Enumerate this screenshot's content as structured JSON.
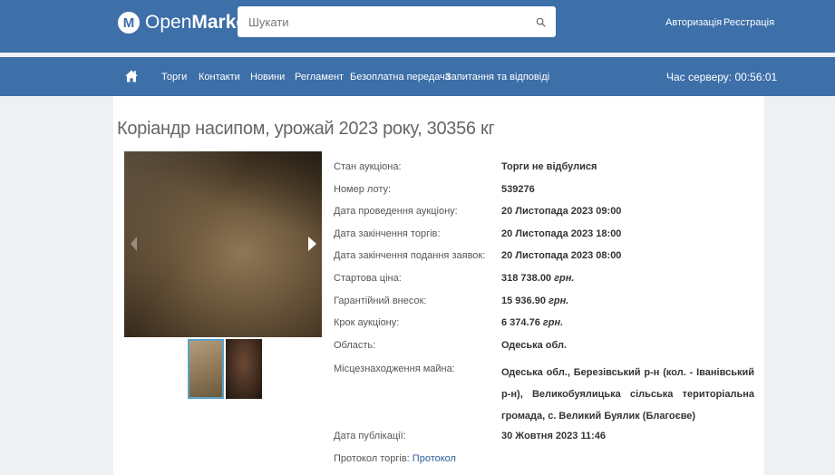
{
  "header": {
    "logo_prefix": "Open",
    "logo_bold": "Market",
    "logo_mark": "M",
    "search_placeholder": "Шукати",
    "search_icon": "search-icon",
    "login": "Авторизація",
    "register": "Реєстрація"
  },
  "nav": {
    "home_icon": "home-icon",
    "items": [
      "Торги",
      "Контакти",
      "Новини",
      "Регламент",
      "Безоплатна передача",
      "Запитання та відповіді"
    ],
    "server_time_label": "Час серверу:",
    "server_time": "00:56:01"
  },
  "lot": {
    "title": "Коріандр насипом, урожай 2023 року, 30356 кг",
    "status_label": "Стан аукціона:",
    "status_value": "Торги не відбулися",
    "lot_number_label": "Номер лоту:",
    "lot_number_value": "539276",
    "auction_date_label": "Дата проведення аукціону:",
    "auction_date_value": "20 Листопада 2023 09:00",
    "end_date_label": "Дата закінчення торгів:",
    "end_date_value": "20 Листопада 2023 18:00",
    "applications_end_label": "Дата закінчення подання заявок:",
    "applications_end_value": "20 Листопада 2023 08:00",
    "start_price_label": "Стартова ціна:",
    "start_price_value": "318 738.00",
    "guarantee_label": "Гарантійний внесок:",
    "guarantee_value": "15 936.90",
    "step_label": "Крок аукціону:",
    "step_value": "6 374.76",
    "currency": "грн.",
    "region_label": "Область:",
    "region_value": "Одеська обл.",
    "location_label": "Місцезнаходження майна:",
    "location_value": "Одеська обл., Березівський р-н (кол. - Іванівський р-н), Великобуялицька сільська територіальна громада, с. Великий Буялик (Благоєве)",
    "published_label": "Дата публікації:",
    "published_value": "30 Жовтня 2023 11:46",
    "protocol_label": "Протокол торгів:",
    "protocol_link": "Протокол"
  },
  "colors": {
    "brand": "#3d6fa8",
    "thumb_active_border": "#5aa0c8",
    "link": "#2a5e93"
  }
}
